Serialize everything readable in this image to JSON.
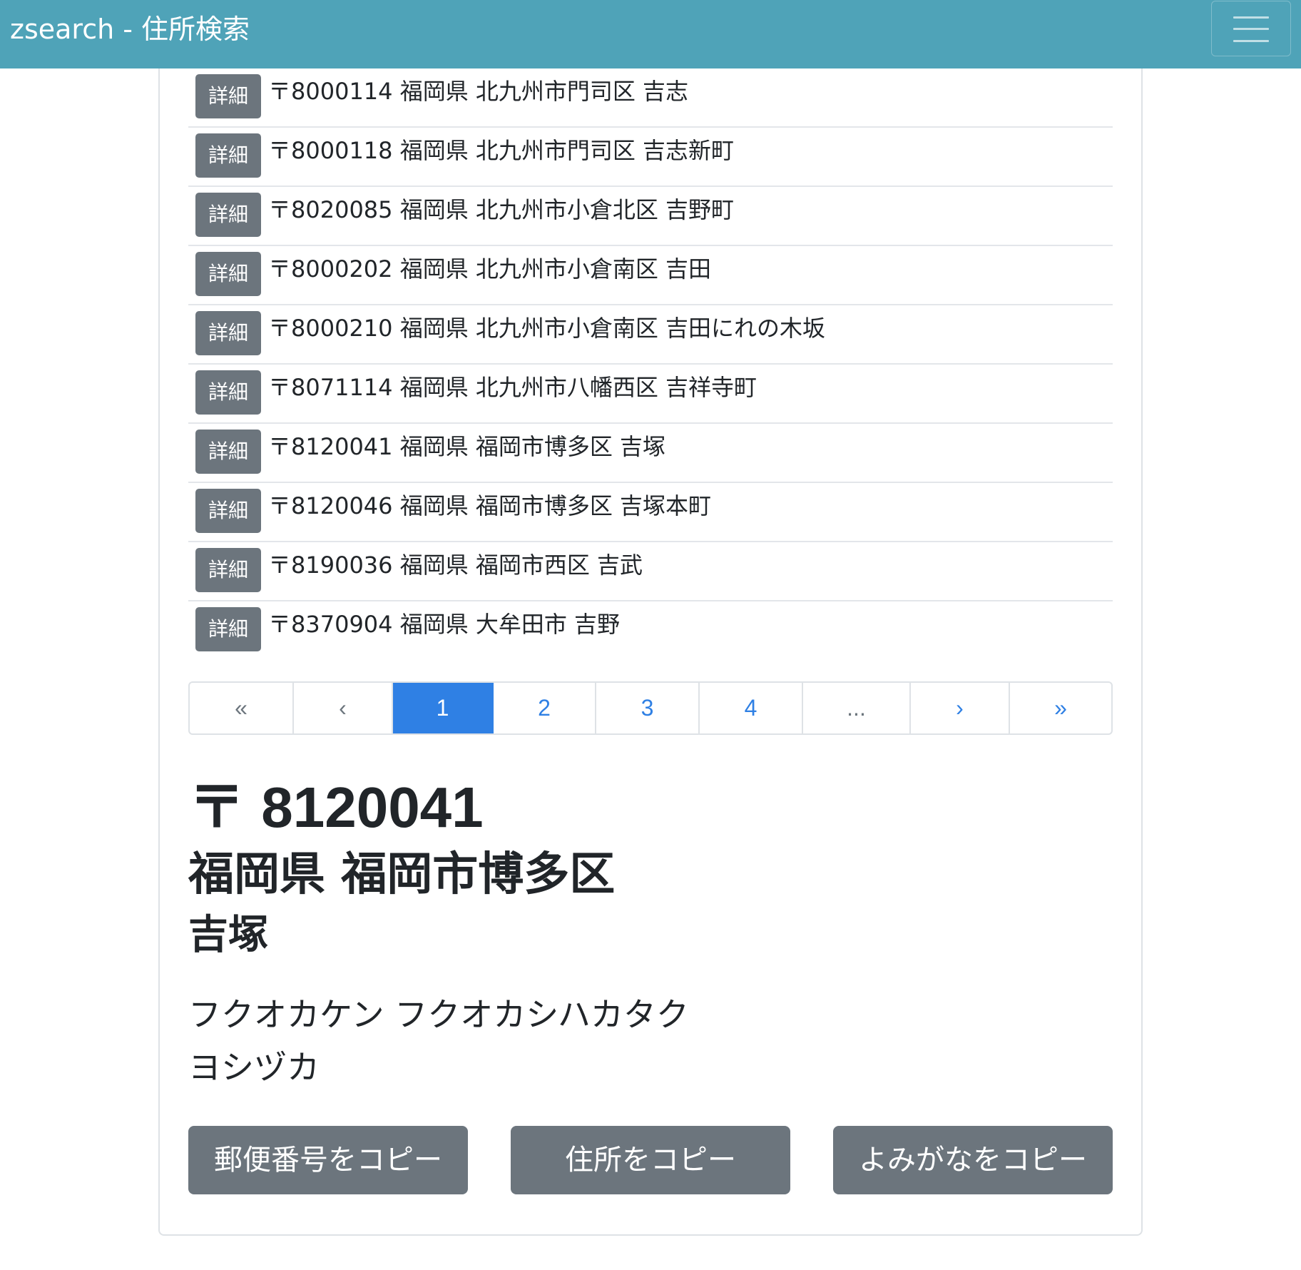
{
  "navbar": {
    "brand": "zsearch - 住所検索"
  },
  "results": [
    {
      "button": "詳細",
      "text": "〒8000114 福岡県 北九州市門司区 吉志"
    },
    {
      "button": "詳細",
      "text": "〒8000118 福岡県 北九州市門司区 吉志新町"
    },
    {
      "button": "詳細",
      "text": "〒8020085 福岡県 北九州市小倉北区 吉野町"
    },
    {
      "button": "詳細",
      "text": "〒8000202 福岡県 北九州市小倉南区 吉田"
    },
    {
      "button": "詳細",
      "text": "〒8000210 福岡県 北九州市小倉南区 吉田にれの木坂"
    },
    {
      "button": "詳細",
      "text": "〒8071114 福岡県 北九州市八幡西区 吉祥寺町"
    },
    {
      "button": "詳細",
      "text": "〒8120041 福岡県 福岡市博多区 吉塚"
    },
    {
      "button": "詳細",
      "text": "〒8120046 福岡県 福岡市博多区 吉塚本町"
    },
    {
      "button": "詳細",
      "text": "〒8190036 福岡県 福岡市西区 吉武"
    },
    {
      "button": "詳細",
      "text": "〒8370904 福岡県 大牟田市 吉野"
    }
  ],
  "pagination": {
    "first": "«",
    "prev": "‹",
    "pages": [
      "1",
      "2",
      "3",
      "4"
    ],
    "current": "1",
    "ellipsis": "...",
    "next": "›",
    "last": "»"
  },
  "detail": {
    "postal": "〒 8120041",
    "pref_city": "福岡県 福岡市博多区",
    "town": "吉塚",
    "kana_pref_city": "フクオカケン フクオカシハカタク",
    "kana_town": "ヨシヅカ"
  },
  "actions": {
    "copy_postal": "郵便番号をコピー",
    "copy_address": "住所をコピー",
    "copy_reading": "よみがなをコピー"
  },
  "colors": {
    "navbar": "#4fa3b8",
    "button_secondary": "#6c757d",
    "link": "#2f80e4",
    "active_page": "#2f80e4"
  }
}
